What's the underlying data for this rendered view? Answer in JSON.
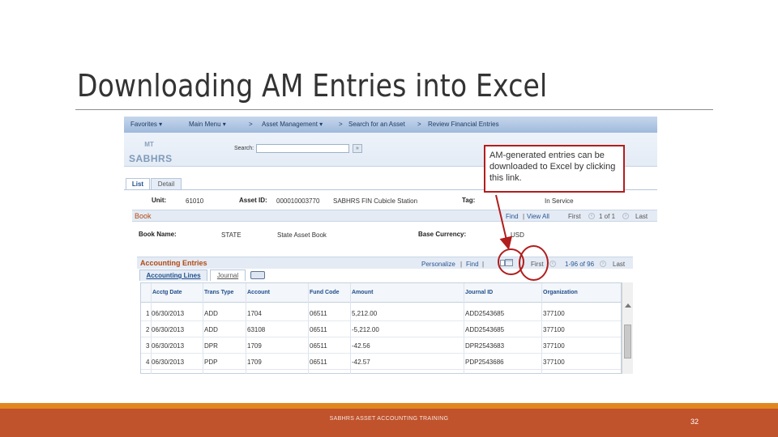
{
  "slide": {
    "title": "Downloading AM Entries into Excel",
    "footer": "SABHRS ASSET ACCOUNTING TRAINING",
    "page_number": "32"
  },
  "app": {
    "topnav": {
      "favorites": "Favorites ▾",
      "main_menu": "Main Menu ▾",
      "sep1": ">",
      "asset_mgmt": "Asset Management ▾",
      "sep2": ">",
      "search_asset": "Search for an Asset",
      "sep3": ">",
      "review": "Review Financial Entries"
    },
    "logo_mt": "MT",
    "logo": "SABHRS",
    "search_label": "Search:",
    "search_btn": "»",
    "tabs": [
      "List",
      "Detail"
    ],
    "unit_label": "Unit:",
    "unit_value": "61010",
    "asset_id_label": "Asset ID:",
    "asset_id_value": "000010003770",
    "asset_desc": "SABHRS FIN Cubicle Station",
    "tag_label": "Tag:",
    "status_value": "In Service",
    "book_section": "Book",
    "book_nav": {
      "find": "Find",
      "sep": "|",
      "view_all": "View All",
      "first": "First",
      "range": "1 of 1",
      "last": "Last"
    },
    "book_name_label": "Book Name:",
    "book_name_value": "STATE",
    "book_desc": "State Asset Book",
    "currency_label": "Base Currency:",
    "currency_value": "USD",
    "ae_section": "Accounting Entries",
    "ae_nav": {
      "personalize": "Personalize",
      "sep1": "|",
      "find": "Find",
      "sep2": "|",
      "first": "First",
      "range": "1-96 of 96",
      "last": "Last"
    },
    "subtabs": [
      "Accounting Lines",
      "Journal"
    ],
    "columns": [
      "Acctg Date",
      "Trans Type",
      "Account",
      "Fund Code",
      "Amount",
      "Journal ID",
      "Organization"
    ],
    "rows": [
      {
        "num": "1",
        "date": "06/30/2013",
        "type": "ADD",
        "account": "1704",
        "fund": "06511",
        "amount": "5,212.00",
        "journal": "ADD2543685",
        "org": "377100"
      },
      {
        "num": "2",
        "date": "06/30/2013",
        "type": "ADD",
        "account": "63108",
        "fund": "06511",
        "amount": "-5,212.00",
        "journal": "ADD2543685",
        "org": "377100"
      },
      {
        "num": "3",
        "date": "06/30/2013",
        "type": "DPR",
        "account": "1709",
        "fund": "06511",
        "amount": "-42.56",
        "journal": "DPR2543683",
        "org": "377100"
      },
      {
        "num": "4",
        "date": "06/30/2013",
        "type": "PDP",
        "account": "1709",
        "fund": "06511",
        "amount": "-42.57",
        "journal": "PDP2543686",
        "org": "377100"
      }
    ]
  },
  "callout": {
    "text": "AM-generated entries can be downloaded to Excel by clicking this link.",
    "border_color": "#b21d1d"
  },
  "colors": {
    "footer": "#c0522c",
    "footer_accent": "#e2871f",
    "section_title": "#b24a12"
  }
}
